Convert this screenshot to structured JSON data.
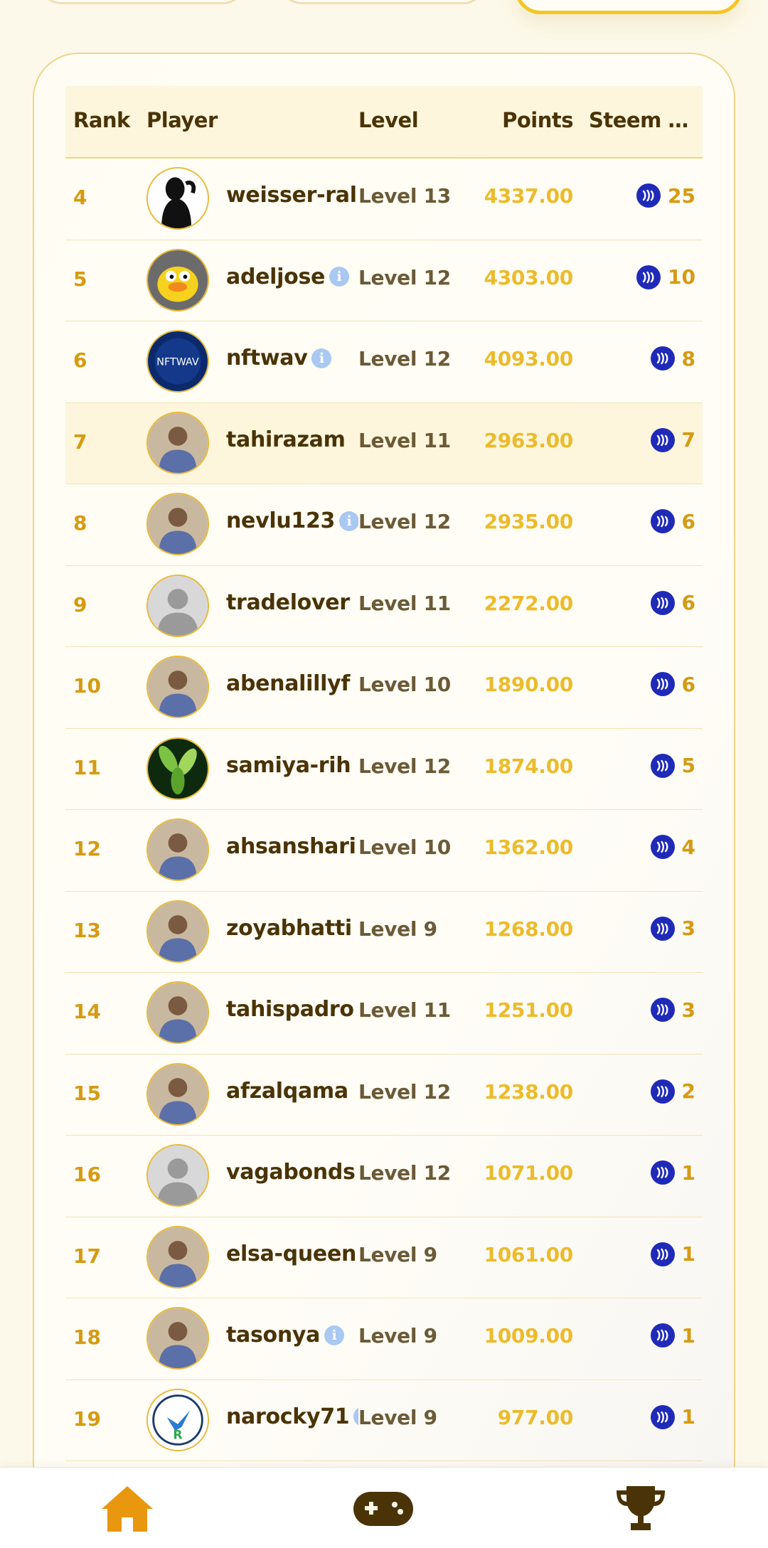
{
  "colors": {
    "accent": "#F3C623",
    "rank_text": "#D69A12",
    "points_text": "#ECBB2A",
    "player_text": "#4A3306",
    "steem_blue": "#1F2AB8",
    "nav_home": "#E8970F",
    "nav_dark": "#4A3306"
  },
  "table": {
    "headers": {
      "rank": "Rank",
      "player": "Player",
      "level": "Level",
      "points": "Points",
      "steem": "Steem R..."
    },
    "rows": [
      {
        "rank": "4",
        "player": "weisser-ral",
        "info": false,
        "level": "Level 13",
        "points": "4337.00",
        "steem": "25",
        "avatar": "silhouette-avatar-icon"
      },
      {
        "rank": "5",
        "player": "adeljose",
        "info": true,
        "level": "Level 12",
        "points": "4303.00",
        "steem": "10",
        "avatar": "duck-avatar-icon"
      },
      {
        "rank": "6",
        "player": "nftwav",
        "info": true,
        "level": "Level 12",
        "points": "4093.00",
        "steem": "8",
        "avatar": "nftwav-logo-icon"
      },
      {
        "rank": "7",
        "player": "tahirazam",
        "info": false,
        "level": "Level 11",
        "points": "2963.00",
        "steem": "7",
        "avatar": "photo-avatar-icon"
      },
      {
        "rank": "8",
        "player": "nevlu123",
        "info": true,
        "level": "Level 12",
        "points": "2935.00",
        "steem": "6",
        "avatar": "photo-avatar-icon"
      },
      {
        "rank": "9",
        "player": "tradelover",
        "info": false,
        "level": "Level 11",
        "points": "2272.00",
        "steem": "6",
        "avatar": "default-user-icon"
      },
      {
        "rank": "10",
        "player": "abenalillyf",
        "info": false,
        "level": "Level 10",
        "points": "1890.00",
        "steem": "6",
        "avatar": "photo-avatar-icon"
      },
      {
        "rank": "11",
        "player": "samiya-rih",
        "info": false,
        "level": "Level 12",
        "points": "1874.00",
        "steem": "5",
        "avatar": "leaves-avatar-icon"
      },
      {
        "rank": "12",
        "player": "ahsanshari",
        "info": false,
        "level": "Level 10",
        "points": "1362.00",
        "steem": "4",
        "avatar": "photo-avatar-icon"
      },
      {
        "rank": "13",
        "player": "zoyabhatti",
        "info": false,
        "level": "Level 9",
        "points": "1268.00",
        "steem": "3",
        "avatar": "photo-avatar-icon"
      },
      {
        "rank": "14",
        "player": "tahispadro",
        "info": false,
        "level": "Level 11",
        "points": "1251.00",
        "steem": "3",
        "avatar": "photo-avatar-icon"
      },
      {
        "rank": "15",
        "player": "afzalqama",
        "info": false,
        "level": "Level 12",
        "points": "1238.00",
        "steem": "2",
        "avatar": "photo-avatar-icon"
      },
      {
        "rank": "16",
        "player": "vagabonds",
        "info": false,
        "level": "Level 12",
        "points": "1071.00",
        "steem": "1",
        "avatar": "default-user-icon"
      },
      {
        "rank": "17",
        "player": "elsa-queen",
        "info": false,
        "level": "Level 9",
        "points": "1061.00",
        "steem": "1",
        "avatar": "photo-avatar-icon"
      },
      {
        "rank": "18",
        "player": "tasonya",
        "info": true,
        "level": "Level 9",
        "points": "1009.00",
        "steem": "1",
        "avatar": "photo-avatar-icon"
      },
      {
        "rank": "19",
        "player": "narocky71",
        "info": true,
        "level": "Level 9",
        "points": "977.00",
        "steem": "1",
        "avatar": "bird-logo-icon"
      }
    ]
  },
  "nav": {
    "items": [
      {
        "name": "home",
        "icon": "home-icon"
      },
      {
        "name": "games",
        "icon": "gamepad-icon"
      },
      {
        "name": "leaderboard",
        "icon": "trophy-icon"
      }
    ]
  }
}
